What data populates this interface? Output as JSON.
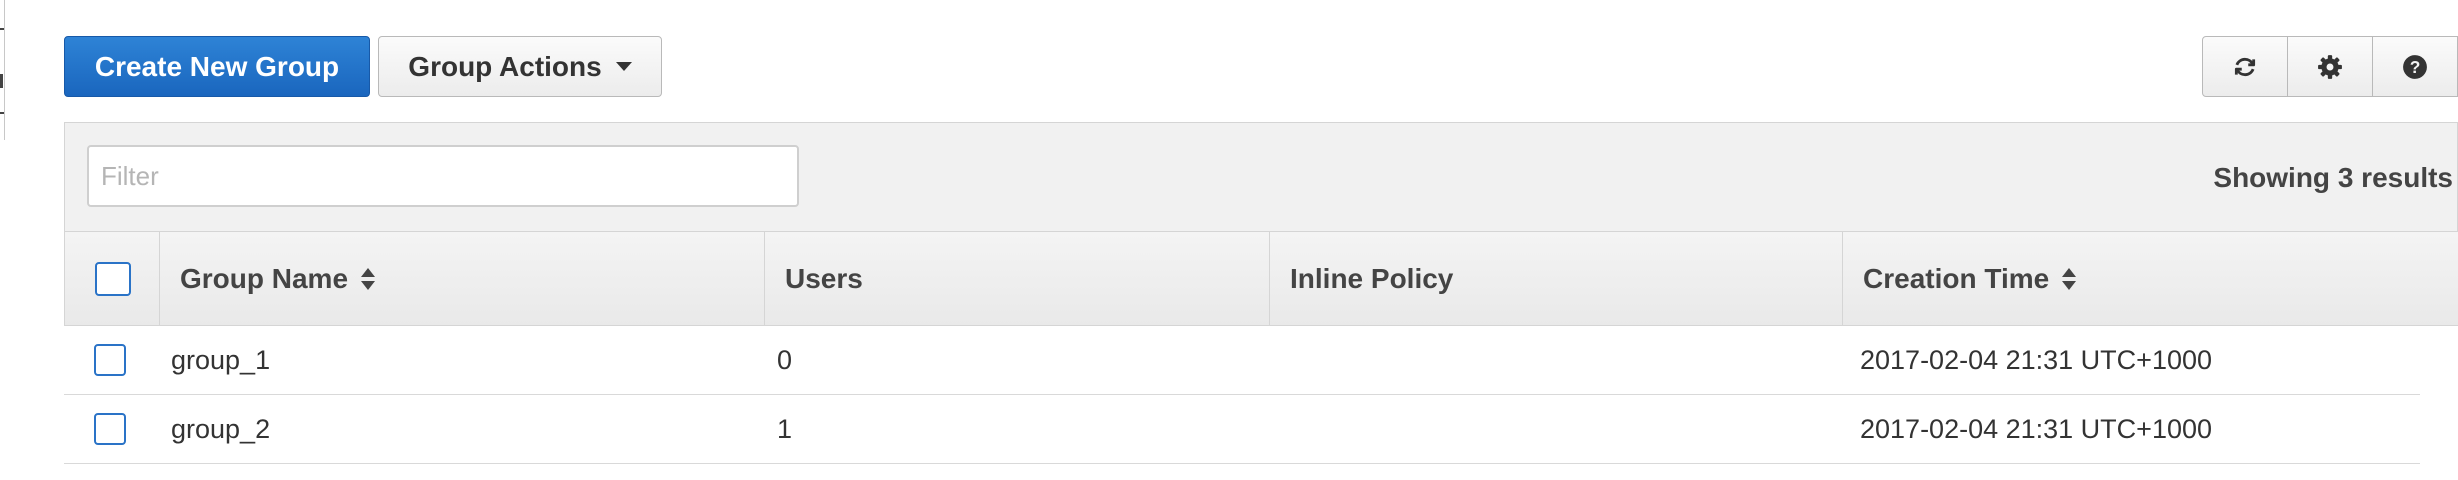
{
  "toolbar": {
    "create_label": "Create New Group",
    "actions_label": "Group Actions"
  },
  "icons": {
    "refresh": "refresh-icon",
    "settings": "gear-icon",
    "help": "help-icon",
    "sort": "sort-icon",
    "dropdown": "caret-down-icon"
  },
  "filter": {
    "placeholder": "Filter",
    "value": ""
  },
  "results_text": "Showing 3 results",
  "table": {
    "columns": [
      "Group Name",
      "Users",
      "Inline Policy",
      "Creation Time"
    ],
    "rows": [
      {
        "name": "group_1",
        "users": "0",
        "policy": "",
        "created": "2017-02-04 21:31 UTC+1000"
      },
      {
        "name": "group_2",
        "users": "1",
        "policy": "",
        "created": "2017-02-04 21:31 UTC+1000"
      }
    ]
  },
  "colors": {
    "primary": "#1a66be",
    "checkbox_border": "#2a73c7",
    "header_bg": "#f1f1f1"
  }
}
